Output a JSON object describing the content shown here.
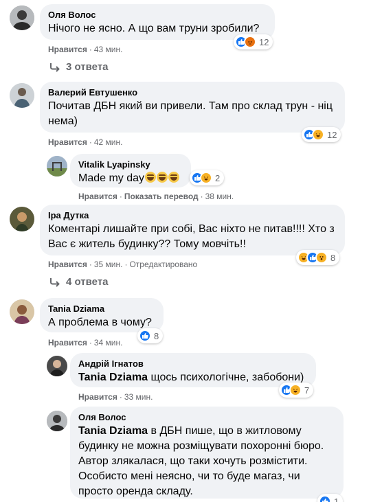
{
  "comments": [
    {
      "name": "Оля Волос",
      "text": "Нічого не ясно. А що вам труни зробили?",
      "like_label": "Нравится",
      "time": "43 мин.",
      "reaction_count": "12",
      "reactions": [
        "like-icon",
        "angry-icon"
      ],
      "replies_label": "3 ответа"
    },
    {
      "name": "Валерий Евтушенко",
      "text": "Почитав ДБН який ви привели. Там про склад трун - ніц нема)",
      "like_label": "Нравится",
      "time": "42 мин.",
      "reaction_count": "12",
      "reactions": [
        "like-icon",
        "haha-icon"
      ]
    },
    {
      "name": "Vitalik Lyapinsky",
      "text": "Made my day",
      "like_label": "Нравится",
      "translate_label": "Показать перевод",
      "time": "38 мин.",
      "reaction_count": "2",
      "reactions": [
        "like-icon",
        "haha-icon"
      ]
    },
    {
      "name": "Іра Дутка",
      "text": "Коментарі лишайте при собі, Вас ніхто не питав!!!! Хто з Вас є житель будинку?? Тому мовчіть!!",
      "like_label": "Нравится",
      "time": "35 мин.",
      "edited_label": "Отредактировано",
      "reaction_count": "8",
      "reactions": [
        "haha-icon",
        "like-icon",
        "wow-icon"
      ],
      "replies_label": "4 ответа"
    },
    {
      "name": "Tania Dziama",
      "text": "А проблема в чому?",
      "like_label": "Нравится",
      "time": "34 мин.",
      "reaction_count": "8",
      "reactions": [
        "like-icon"
      ]
    },
    {
      "name": "Андрій Ігнатов",
      "mention": "Tania Dziama",
      "text": " щось психологічне, забобони)",
      "like_label": "Нравится",
      "time": "33 мин.",
      "reaction_count": "7",
      "reactions": [
        "like-icon",
        "haha-icon"
      ]
    },
    {
      "name": "Оля Волос",
      "mention": "Tania Dziama",
      "text": " в ДБН пише, що в житловому будинку не можна розміщувати похоронні бюро. Автор злякалася, що таки хочуть розмістити. Особисто мені неясно, чи то буде магаз, чи просто оренда складу.",
      "reaction_count": "1",
      "reactions": [
        "like-icon"
      ]
    }
  ],
  "colors": {
    "bubble": "#f0f2f5",
    "like": "#1877f2",
    "haha": "#f7b125",
    "angry": "#e9710f",
    "meta": "#65676b"
  }
}
